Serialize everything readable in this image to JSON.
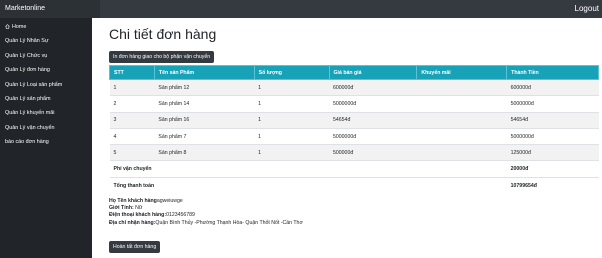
{
  "topbar": {
    "brand": "Marketonline",
    "logout": "Logout"
  },
  "sidebar": {
    "items": [
      {
        "label": "Home",
        "icon": "home-icon"
      },
      {
        "label": "Quản Lý Nhân Sự"
      },
      {
        "label": "Quản Lý Chức vụ"
      },
      {
        "label": "Quản Lý đơn hàng"
      },
      {
        "label": "Quản Lý Loại sản phẩm"
      },
      {
        "label": "Quản Lý sản phẩm"
      },
      {
        "label": "Quản Lý khuyến mãi"
      },
      {
        "label": "Quản Lý vận chuyển"
      },
      {
        "label": "báo cáo đơn hàng"
      }
    ]
  },
  "main": {
    "title": "Chi tiết đơn hàng",
    "print_button": "In đơn hàng giao cho bộ phận vận chuyển",
    "table": {
      "headers": [
        "STT",
        "Tên sản Phẩm",
        "Số lượng",
        "Giá bán giá",
        "Khuyến mãi",
        "Thành Tiền"
      ],
      "rows": [
        [
          "1",
          "Sản phẩm 12",
          "1",
          "600000đ",
          "",
          "600000đ"
        ],
        [
          "2",
          "Sản phẩm 14",
          "1",
          "5000000đ",
          "",
          "5000000đ"
        ],
        [
          "3",
          "Sản phẩm 16",
          "1",
          "54654đ",
          "",
          "54654đ"
        ],
        [
          "4",
          "Sản phẩm 7",
          "1",
          "5000000đ",
          "",
          "5000000đ"
        ],
        [
          "5",
          "Sản phẩm 8",
          "1",
          "500000đ",
          "",
          "125000đ"
        ]
      ],
      "shipping_label": "Phí vận chuyển",
      "shipping_value": "20000đ",
      "total_label": "Tổng thanh toán",
      "total_value": "10799654đ"
    },
    "customer": {
      "name_label": "Họ Tên khách hàng",
      "name_value": "agweiuwge",
      "gender_label": "Giới Tính:",
      "gender_value": " Nữ",
      "phone_label": "Điện thoại khách hàng:",
      "phone_value": "0123456789",
      "address_label": "Địa chỉ nhận hàng:",
      "address_value": "Quận Bình Thủy -Phường Thạnh Hòa- Quận Thốt Nốt -Cần Thơ"
    },
    "finish_button": "Hoàn tất đơn hàng"
  }
}
